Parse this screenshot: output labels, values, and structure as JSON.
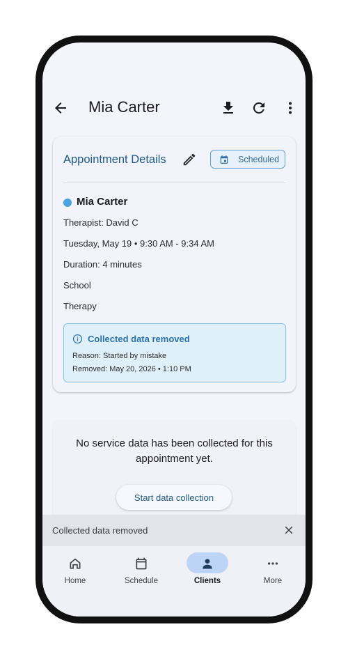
{
  "app_bar": {
    "title": "Mia Carter",
    "icons": [
      "back-arrow-icon",
      "download-icon",
      "refresh-icon",
      "more-vert-icon"
    ]
  },
  "appointment": {
    "header": "Appointment Details",
    "status_chip": "Scheduled",
    "client_name": "Mia Carter",
    "therapist": "Therapist: David C",
    "datetime": "Tuesday, May 19 • 9:30 AM - 9:34 AM",
    "duration": "Duration: 4 minutes",
    "location": "School",
    "service": "Therapy",
    "status_dot_color": "#4aa3e2"
  },
  "alert": {
    "title": "Collected data removed",
    "reason": "Reason: Started by mistake",
    "removed": "Removed: May 20, 2026 • 1:10 PM"
  },
  "service_data": {
    "message": "No service data has been collected for this appointment yet.",
    "button": "Start data collection"
  },
  "snackbar": {
    "text": "Collected data removed"
  },
  "nav": {
    "items": [
      {
        "label": "Home",
        "icon": "home-icon"
      },
      {
        "label": "Schedule",
        "icon": "calendar-icon"
      },
      {
        "label": "Clients",
        "icon": "person-icon",
        "active": true
      },
      {
        "label": "More",
        "icon": "more-horiz-icon"
      }
    ]
  },
  "colors": {
    "accent": "#1f5a8d",
    "chip_border": "#5ea0d3",
    "alert_bg": "#e0f0fa",
    "nav_active_pill": "#bcd5f7"
  }
}
